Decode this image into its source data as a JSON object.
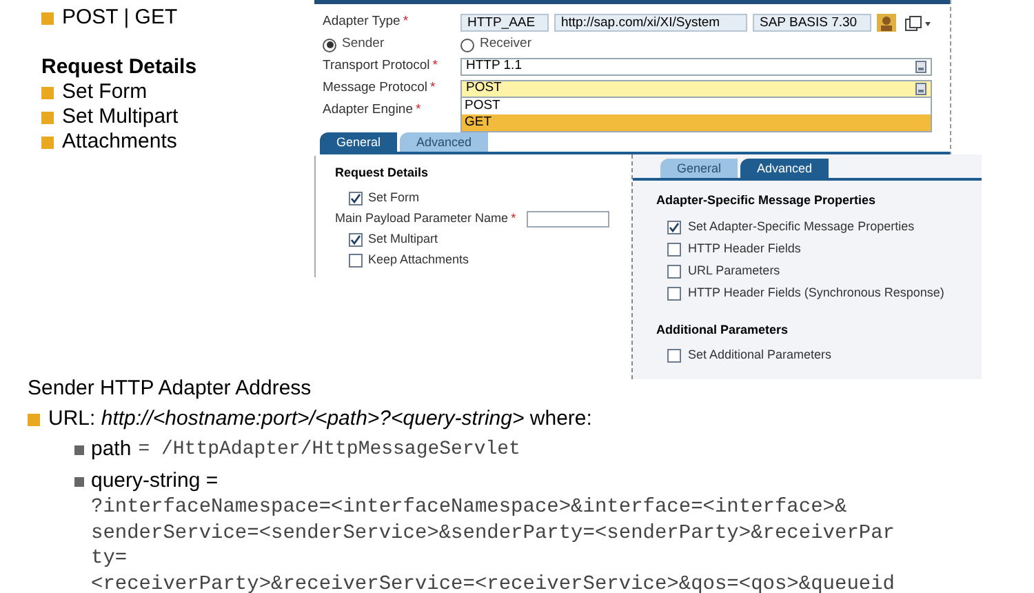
{
  "top_bullets": [
    "POST | GET"
  ],
  "request_details": {
    "title": "Request Details",
    "items": [
      "Set Form",
      "Set Multipart",
      "Attachments"
    ]
  },
  "adapter_window": {
    "required_mark": "*",
    "adapter_type_label": "Adapter Type",
    "adapter_type_values": [
      "HTTP_AAE",
      "http://sap.com/xi/XI/System",
      "SAP BASIS 7.30"
    ],
    "direction": [
      {
        "label": "Sender",
        "selected": true
      },
      {
        "label": "Receiver",
        "selected": false
      }
    ],
    "fields": [
      {
        "label": "Transport Protocol",
        "value": "HTTP 1.1",
        "highlighted": false
      },
      {
        "label": "Message Protocol",
        "value": "POST",
        "highlighted": true
      }
    ],
    "dropdown_options": [
      {
        "label": "POST",
        "selected": false
      },
      {
        "label": "GET",
        "selected": true
      }
    ],
    "adapter_engine_label": "Adapter Engine",
    "tabs": [
      {
        "label": "General",
        "selected": true
      },
      {
        "label": "Advanced",
        "selected": false
      }
    ]
  },
  "general_panel": {
    "title": "Request Details",
    "rows": [
      {
        "kind": "checkbox",
        "label": "Set Form",
        "checked": true
      },
      {
        "kind": "field",
        "label": "Main Payload Parameter Name",
        "required": true
      },
      {
        "kind": "checkbox",
        "label": "Set Multipart",
        "checked": true
      },
      {
        "kind": "checkbox",
        "label": "Keep Attachments",
        "checked": false
      }
    ]
  },
  "advanced_panel": {
    "tabs": [
      {
        "label": "General",
        "selected": false
      },
      {
        "label": "Advanced",
        "selected": true
      }
    ],
    "sections": [
      {
        "title": "Adapter-Specific Message Properties",
        "items": [
          {
            "label": "Set Adapter-Specific Message Properties",
            "checked": true
          },
          {
            "label": "HTTP Header Fields",
            "checked": false
          },
          {
            "label": "URL Parameters",
            "checked": false
          },
          {
            "label": "HTTP Header Fields (Synchronous Response)",
            "checked": false
          }
        ]
      },
      {
        "title": "Additional Parameters",
        "items": [
          {
            "label": "Set Additional Parameters",
            "checked": false
          }
        ]
      }
    ]
  },
  "address": {
    "title": "Sender HTTP Adapter Address",
    "url_label": "URL:",
    "url_pattern": "http://<hostname:port>/<path>?<query-string>",
    "url_suffix": "where:",
    "path_label": "path",
    "path_value": "= /HttpAdapter/HttpMessageServlet",
    "query_label": "query-string =",
    "query_lines": [
      "?interfaceNamespace=<interfaceNamespace>&interface=<interface>&",
      "senderService=<senderService>&senderParty=<senderParty>&receiverPar",
      "ty=",
      "<receiverParty>&receiverService=<receiverService>&qos=<qos>&queueid"
    ]
  }
}
